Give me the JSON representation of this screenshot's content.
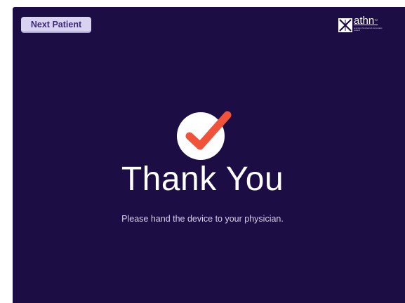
{
  "header": {
    "next_patient_label": "Next Patient"
  },
  "logo": {
    "wordmark": "athn",
    "trademark": "™",
    "tagline": "american thrombosis & hemostasis network"
  },
  "main": {
    "icon": "checkmark-icon",
    "title": "Thank You",
    "message": "Please hand the device to your physician."
  },
  "colors": {
    "background": "#1c0d44",
    "button_bg": "#d9d2f1",
    "button_text": "#3a2a78",
    "check_accent": "#f0533a",
    "text": "#ffffff"
  }
}
